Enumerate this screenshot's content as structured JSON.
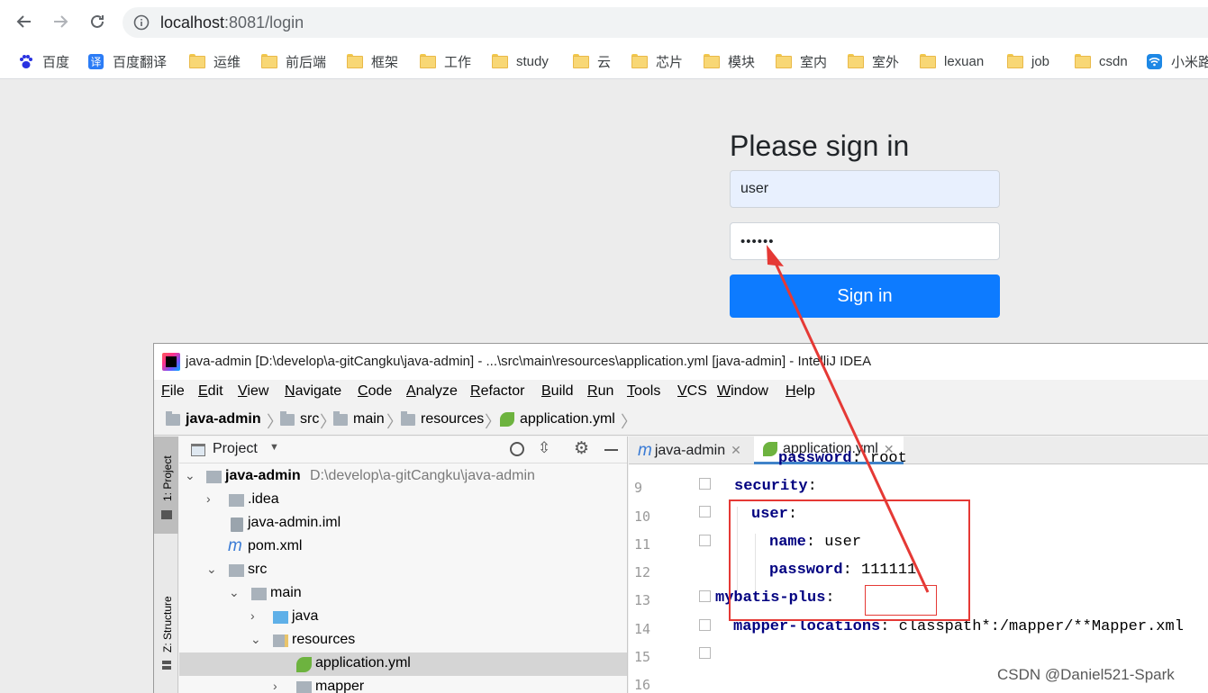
{
  "browser": {
    "url_host": "localhost",
    "url_rest": ":8081/login",
    "bookmarks": [
      {
        "label": "百度",
        "icon": "baidu-paw-icon"
      },
      {
        "label": "百度翻译",
        "icon": "translate-icon"
      },
      {
        "label": "运维",
        "icon": "folder-icon"
      },
      {
        "label": "前后端",
        "icon": "folder-icon"
      },
      {
        "label": "框架",
        "icon": "folder-icon"
      },
      {
        "label": "工作",
        "icon": "folder-icon"
      },
      {
        "label": "study",
        "icon": "folder-icon"
      },
      {
        "label": "云",
        "icon": "folder-icon"
      },
      {
        "label": "芯片",
        "icon": "folder-icon"
      },
      {
        "label": "模块",
        "icon": "folder-icon"
      },
      {
        "label": "室内",
        "icon": "folder-icon"
      },
      {
        "label": "室外",
        "icon": "folder-icon"
      },
      {
        "label": "lexuan",
        "icon": "folder-icon"
      },
      {
        "label": "job",
        "icon": "folder-icon"
      },
      {
        "label": "csdn",
        "icon": "folder-icon"
      },
      {
        "label": "小米路",
        "icon": "wifi-icon"
      }
    ]
  },
  "login": {
    "title": "Please sign in",
    "username_value": "user",
    "password_value": "••••••",
    "submit_label": "Sign in",
    "accent": "#0d7bff"
  },
  "ide": {
    "window_title": "java-admin [D:\\develop\\a-gitCangku\\java-admin] - ...\\src\\main\\resources\\application.yml [java-admin] - IntelliJ IDEA",
    "menu": [
      "File",
      "Edit",
      "View",
      "Navigate",
      "Code",
      "Analyze",
      "Refactor",
      "Build",
      "Run",
      "Tools",
      "VCS",
      "Window",
      "Help"
    ],
    "breadcrumb": [
      "java-admin",
      "src",
      "main",
      "resources",
      "application.yml"
    ],
    "side_tabs": {
      "project": "1: Project",
      "structure": "Z: Structure"
    },
    "project_panel": {
      "header": "Project",
      "root_label": "java-admin",
      "root_path": "D:\\develop\\a-gitCangku\\java-admin",
      "items": [
        {
          "label": ".idea"
        },
        {
          "label": "java-admin.iml"
        },
        {
          "label": "pom.xml"
        },
        {
          "label": "src"
        },
        {
          "label": "main"
        },
        {
          "label": "java"
        },
        {
          "label": "resources"
        },
        {
          "label": "application.yml"
        },
        {
          "label": "mapper"
        }
      ]
    },
    "editor": {
      "tabs": [
        "java-admin",
        "application.yml"
      ],
      "tab_badge": "m",
      "line_numbers": [
        "9",
        "10",
        "11",
        "12",
        "13",
        "14",
        "15",
        "16"
      ],
      "lines": [
        {
          "key": "password",
          "value": " root"
        },
        {
          "key": "security",
          "value": ""
        },
        {
          "key": "user",
          "value": ""
        },
        {
          "key": "name",
          "value": " user"
        },
        {
          "key": "password",
          "value": " 111111"
        },
        {
          "key": "mybatis-plus",
          "value": ""
        },
        {
          "key": "mapper-locations",
          "value": " classpath*:/mapper/**Mapper.xml"
        },
        {
          "key": "",
          "value": ""
        }
      ]
    }
  },
  "annotation_color": "#e53935",
  "watermark": "CSDN @Daniel521-Spark"
}
